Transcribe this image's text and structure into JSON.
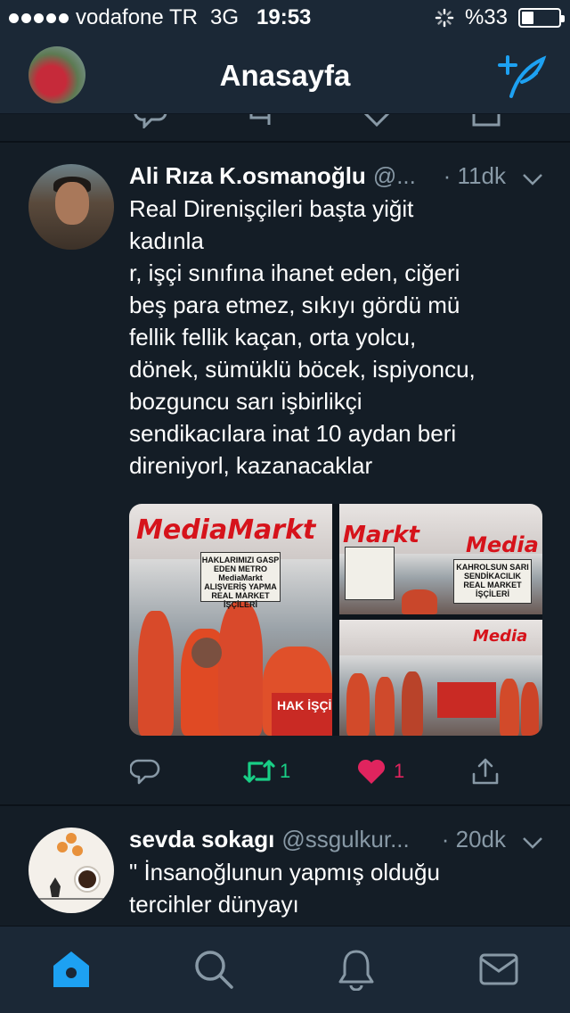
{
  "status_bar": {
    "carrier": "vodafone TR",
    "network": "3G",
    "time": "19:53",
    "battery": "%33",
    "battery_level": 0.33
  },
  "nav": {
    "title": "Anasayfa",
    "compose_icon": "compose-tweet-icon"
  },
  "tweets": [
    {
      "name": "Ali Rıza K.osmanoğlu",
      "handle": "@...",
      "time": "· 11dk",
      "text": "Real Direnişçileri başta yiğit\nkadınla\nr, işçi sınıfına ihanet eden, ciğeri\nbeş para etmez, sıkıyı gördü mü\nfellik fellik kaçan, orta yolcu,\ndönek, sümüklü böcek, ispiyoncu,\nbozguncu sarı işbirlikçi\nsendikacılara inat 10 aydan beri\ndireniyorl, kazanacaklar",
      "retweets": "1",
      "likes": "1",
      "media": {
        "logo_left": "MediaMarkt",
        "logo_right_top": "Markt",
        "logo_right_top2": "Media",
        "logo_right_bottom": "Media",
        "placard_1": "HAKLARIMIZI GASP EDEN METRO MediaMarkt ALIŞVERİŞ YAPMA REAL MARKET İŞÇİLERİ",
        "placard_2": "KAHROLSUN SARI SENDİKACILIK REAL MARKET İŞÇİLERİ",
        "banner_text": "HAK İŞÇİ"
      }
    },
    {
      "name": "sevda sokagı",
      "handle": "@ssgulkur...",
      "time": "· 20dk",
      "text": "\" İnsanoğlunun yapmış olduğu\ntercihler dünyayı"
    }
  ],
  "colors": {
    "background": "#141d26",
    "bar": "#1b2836",
    "accent": "#1da1f2",
    "retweet": "#19cf86",
    "like": "#e0245e",
    "muted": "#8899a6"
  },
  "tabs": [
    "home-icon",
    "search-icon",
    "notifications-icon",
    "messages-icon"
  ]
}
